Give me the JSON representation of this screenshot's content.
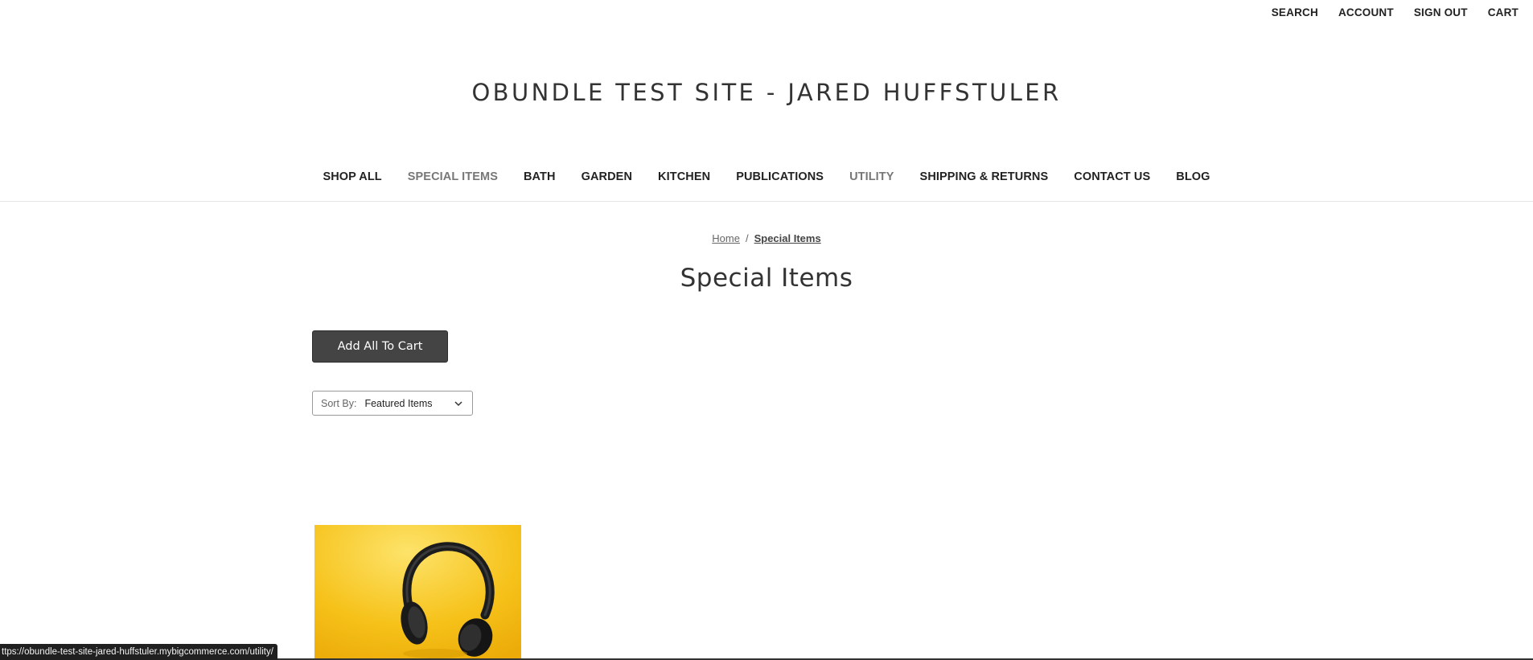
{
  "top_nav": {
    "search": "SEARCH",
    "account": "ACCOUNT",
    "sign_out": "SIGN OUT",
    "cart": "CART"
  },
  "site_title": "OBUNDLE TEST SITE - JARED HUFFSTULER",
  "main_nav": [
    {
      "label": "SHOP ALL"
    },
    {
      "label": "SPECIAL ITEMS"
    },
    {
      "label": "BATH"
    },
    {
      "label": "GARDEN"
    },
    {
      "label": "KITCHEN"
    },
    {
      "label": "PUBLICATIONS"
    },
    {
      "label": "UTILITY"
    },
    {
      "label": "SHIPPING & RETURNS"
    },
    {
      "label": "CONTACT US"
    },
    {
      "label": "BLOG"
    }
  ],
  "breadcrumb": {
    "home": "Home",
    "separator": "/",
    "current": "Special Items"
  },
  "page_title": "Special Items",
  "add_all_button": "Add All To Cart",
  "sort": {
    "label": "Sort By:",
    "selected": "Featured Items"
  },
  "status_bar_url": "ttps://obundle-test-site-jared-huffstuler.mybigcommerce.com/utility/",
  "colors": {
    "button_bg": "#444444",
    "nav_muted": "#777777",
    "product_bg": "#f6c21a"
  }
}
